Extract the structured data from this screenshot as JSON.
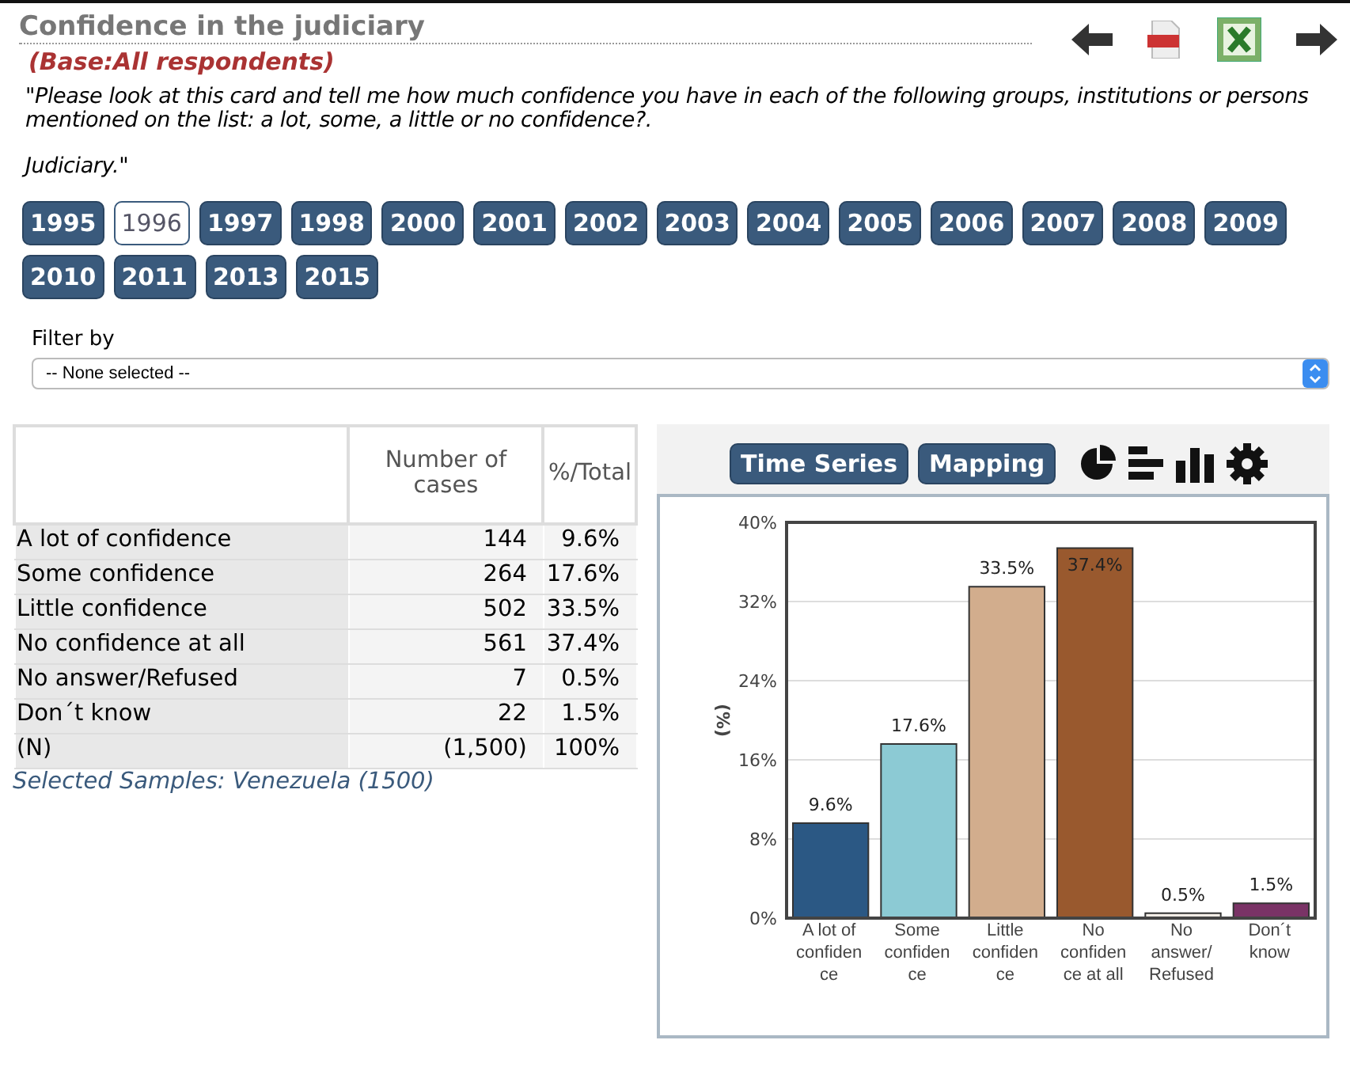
{
  "header": {
    "title": "Confidence in the judiciary",
    "base": "(Base:All respondents)"
  },
  "question": [
    "\"Please look at this card and tell me how much confidence you have in each of the following groups, institutions or persons mentioned on the list: a lot, some, a little or no confidence?.",
    "Judiciary.\""
  ],
  "years": [
    {
      "label": "1995",
      "selected": false
    },
    {
      "label": "1996",
      "selected": true
    },
    {
      "label": "1997",
      "selected": false
    },
    {
      "label": "1998",
      "selected": false
    },
    {
      "label": "2000",
      "selected": false
    },
    {
      "label": "2001",
      "selected": false
    },
    {
      "label": "2002",
      "selected": false
    },
    {
      "label": "2003",
      "selected": false
    },
    {
      "label": "2004",
      "selected": false
    },
    {
      "label": "2005",
      "selected": false
    },
    {
      "label": "2006",
      "selected": false
    },
    {
      "label": "2007",
      "selected": false
    },
    {
      "label": "2008",
      "selected": false
    },
    {
      "label": "2009",
      "selected": false
    },
    {
      "label": "2010",
      "selected": false
    },
    {
      "label": "2011",
      "selected": false
    },
    {
      "label": "2013",
      "selected": false
    },
    {
      "label": "2015",
      "selected": false
    }
  ],
  "filter": {
    "label": "Filter by",
    "value": "-- None selected --"
  },
  "table": {
    "columns": [
      "Number of cases",
      "%/Total"
    ],
    "rows": [
      {
        "label": "A lot of confidence",
        "cases": "144",
        "percent": "9.6%"
      },
      {
        "label": "Some confidence",
        "cases": "264",
        "percent": "17.6%"
      },
      {
        "label": "Little confidence",
        "cases": "502",
        "percent": "33.5%"
      },
      {
        "label": "No confidence at all",
        "cases": "561",
        "percent": "37.4%"
      },
      {
        "label": "No answer/Refused",
        "cases": "7",
        "percent": "0.5%"
      },
      {
        "label": "Don´t know",
        "cases": "22",
        "percent": "1.5%"
      },
      {
        "label": "(N)",
        "cases": "(1,500)",
        "percent": "100%"
      }
    ],
    "note": "Selected Samples: Venezuela (1500)"
  },
  "chart_panel": {
    "buttons": [
      "Time Series",
      "Mapping"
    ],
    "chart_data": {
      "type": "bar",
      "ylabel": "(%)",
      "categories": [
        "A lot of confidence",
        "Some confidence",
        "Little confidence",
        "No confidence at all",
        "No answer/Refused",
        "Don´t know"
      ],
      "grid": true,
      "series": [
        {
          "colors": [
            "#2b5884",
            "#8ccad4",
            "#d2ad8d",
            "#99592e",
            "#f2ede6",
            "#7a3366"
          ],
          "values": [
            9.6,
            17.6,
            33.5,
            37.4,
            0.5,
            1.5
          ]
        }
      ],
      "ylim": [
        0,
        40
      ],
      "yticks": [
        {
          "value": 0,
          "label": "0%"
        },
        {
          "value": 8,
          "label": "8%"
        },
        {
          "value": 16,
          "label": "16%"
        },
        {
          "value": 24,
          "label": "24%"
        },
        {
          "value": 32,
          "label": "32%"
        },
        {
          "value": 40,
          "label": "40%"
        }
      ],
      "value_labels": [
        "9.6%",
        "17.6%",
        "33.5%",
        "37.4%",
        "0.5%",
        "1.5%"
      ]
    }
  }
}
